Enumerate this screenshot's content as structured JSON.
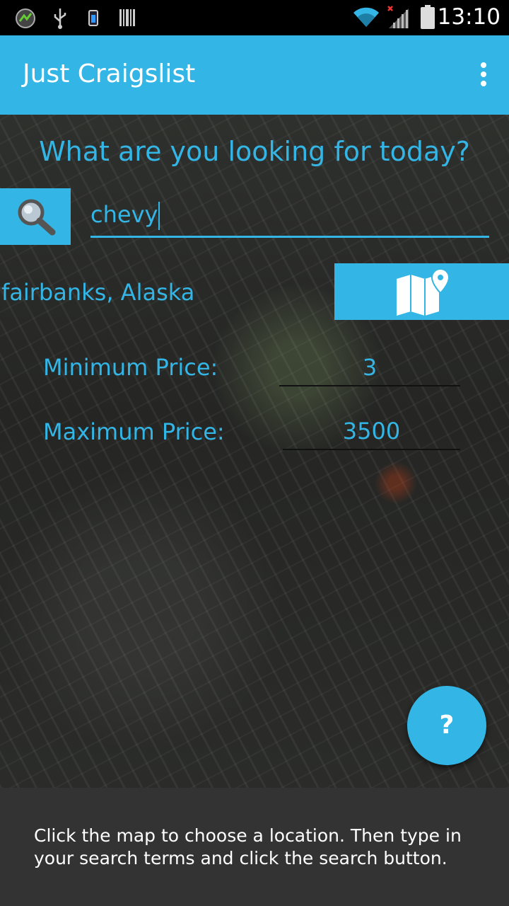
{
  "status_bar": {
    "time": "13:10",
    "icons": [
      "app-notification-icon",
      "usb-icon",
      "battery-saver-icon",
      "barcode-icon",
      "wifi-icon",
      "signal-icon",
      "battery-icon"
    ]
  },
  "app_bar": {
    "title": "Just Craigslist",
    "menu_icon": "overflow-menu-icon"
  },
  "main": {
    "headline": "What are you looking for today?",
    "search": {
      "icon": "search-icon",
      "value": "chevy"
    },
    "location": {
      "label": "fairbanks, Alaska",
      "map_icon": "map-icon"
    },
    "min_price": {
      "label": "Minimum Price:",
      "value": "3"
    },
    "max_price": {
      "label": "Maximum Price:",
      "value": "3500"
    },
    "help_button": {
      "label": "?"
    }
  },
  "info_panel": {
    "text": "Click the map to choose a location. Then type in your search terms and click the search button."
  },
  "colors": {
    "accent": "#33b5e5",
    "panel": "#333333",
    "status_bar": "#000000"
  }
}
